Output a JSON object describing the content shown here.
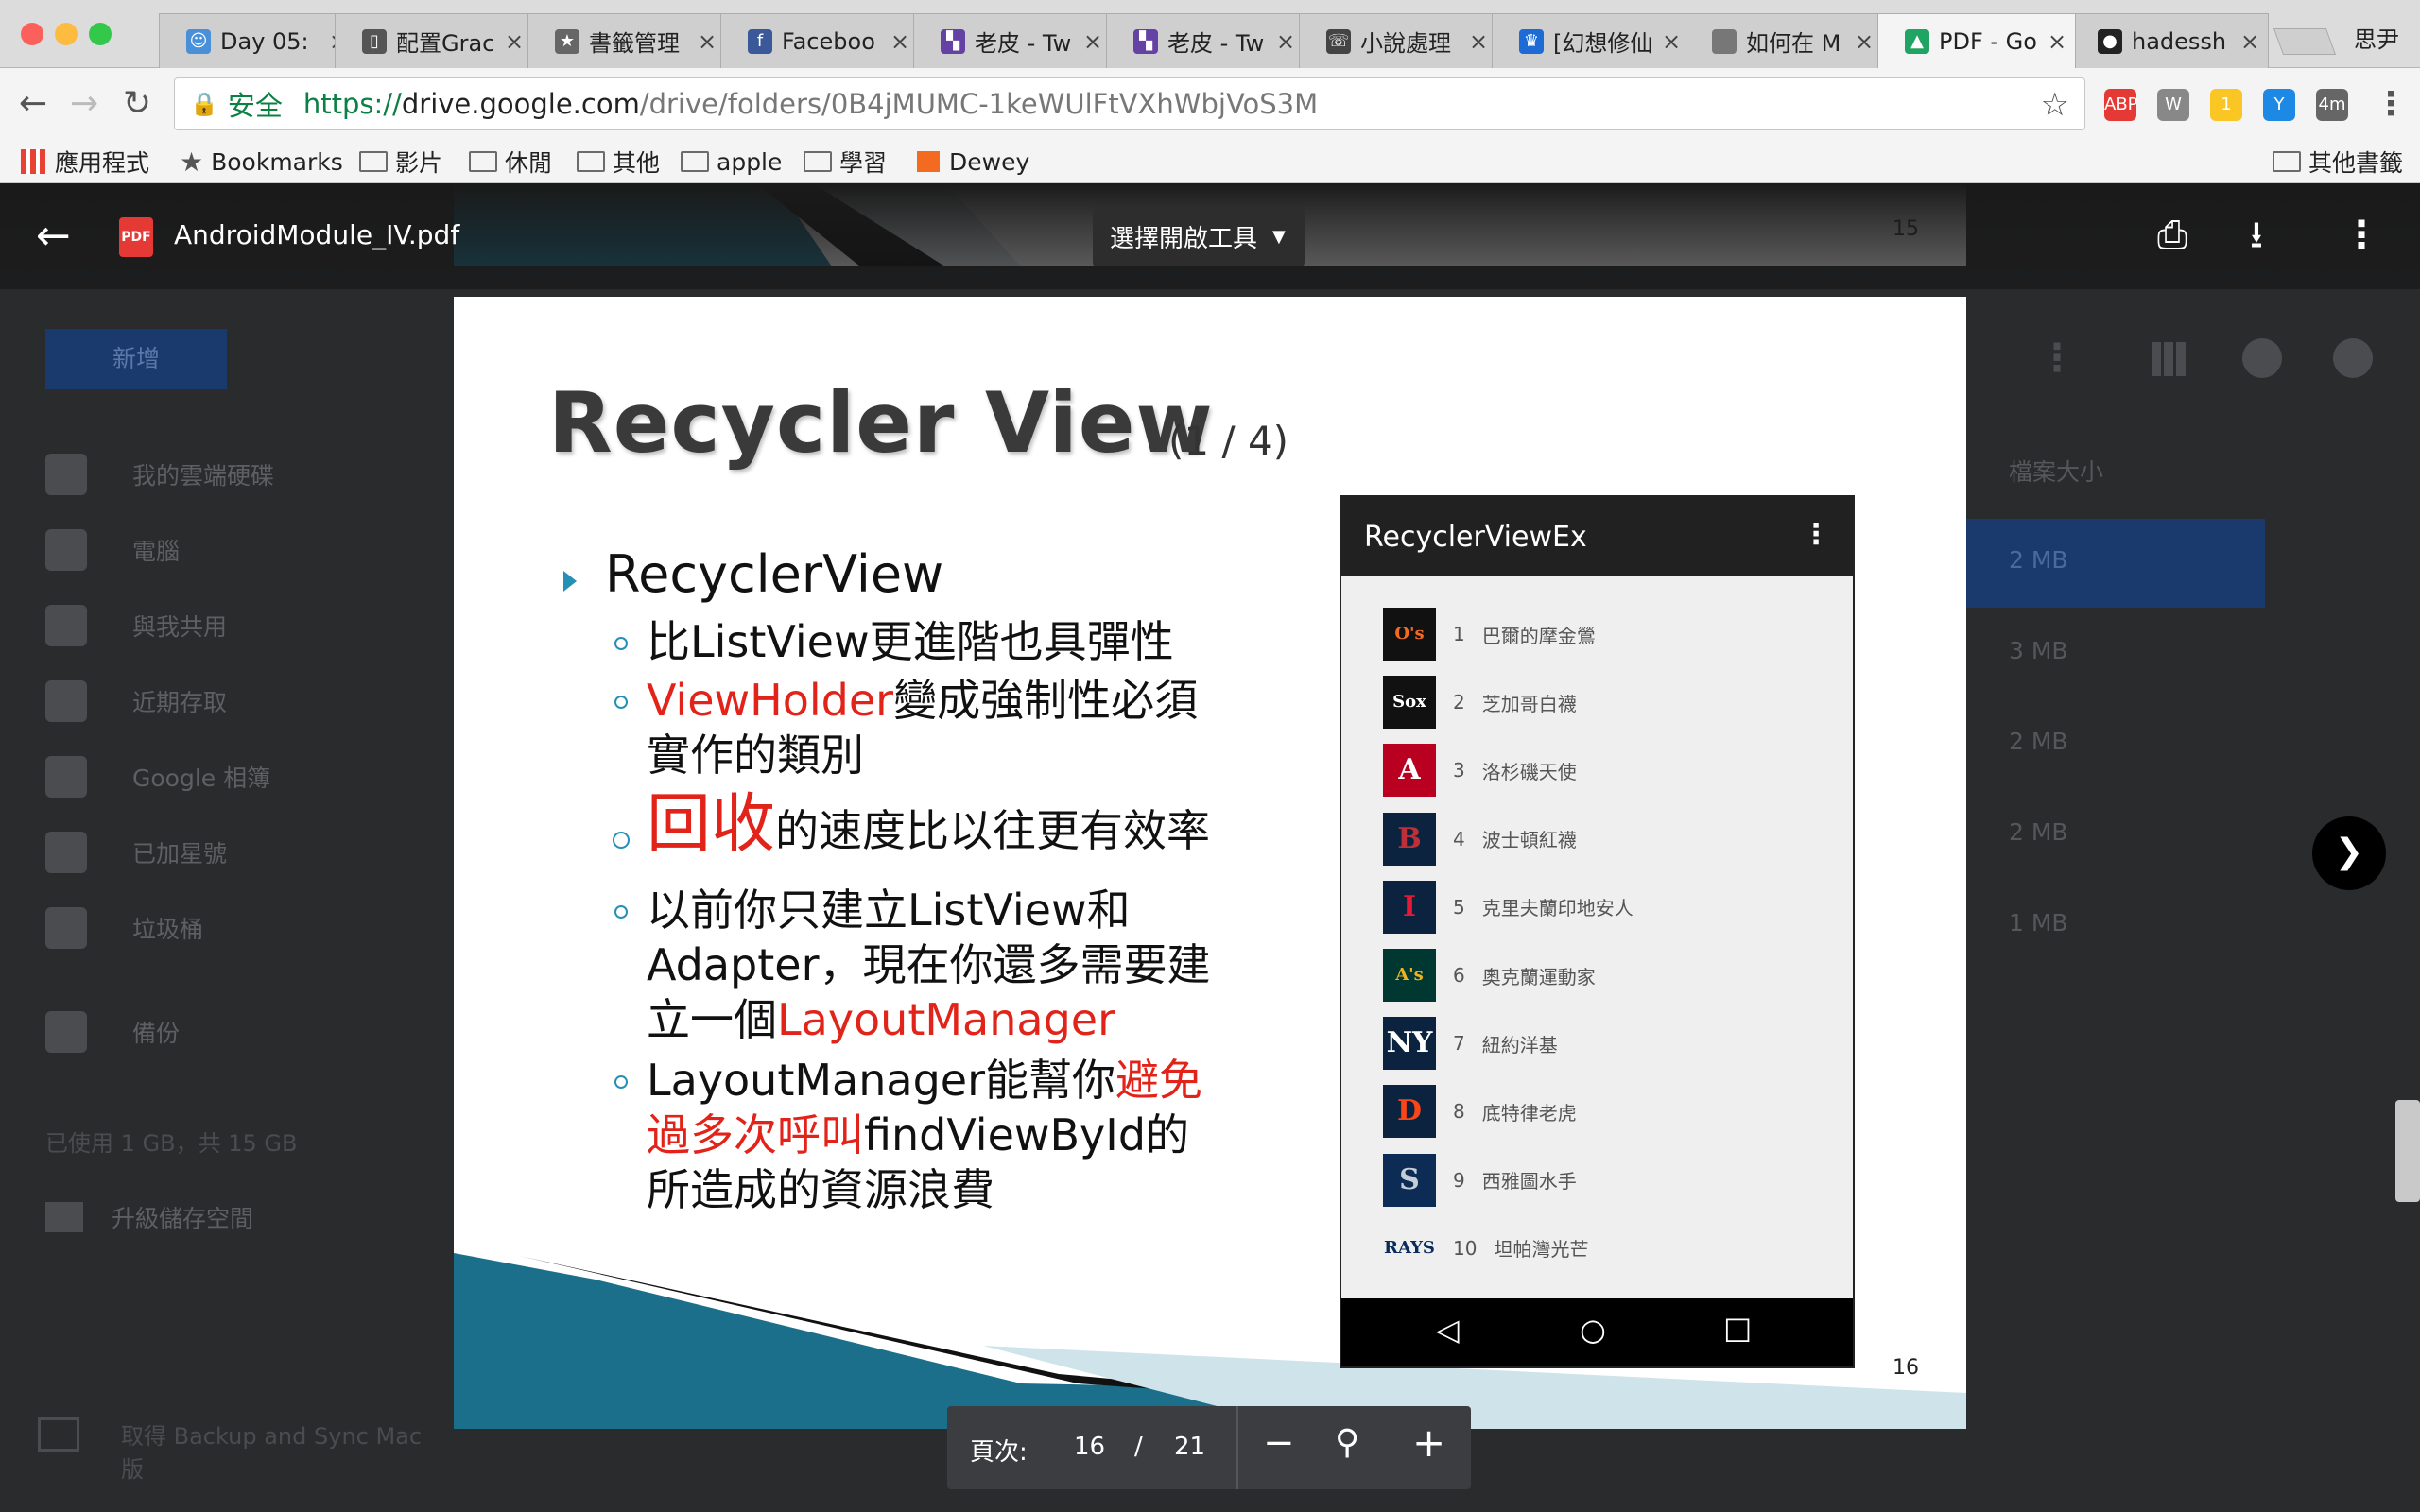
{
  "browser": {
    "tabs": [
      {
        "title": "Day 05:",
        "favicon": "day-icon",
        "active": false
      },
      {
        "title": "配置Grac",
        "favicon": "book-icon",
        "active": false
      },
      {
        "title": "書籤管理",
        "favicon": "star-icon",
        "active": false
      },
      {
        "title": "Faceboo",
        "favicon": "facebook-icon",
        "active": false
      },
      {
        "title": "老皮 - Tw",
        "favicon": "twitch-icon",
        "active": false
      },
      {
        "title": "老皮 - Tw",
        "favicon": "twitch-icon",
        "active": false
      },
      {
        "title": "小說處理",
        "favicon": "phone-icon",
        "active": false
      },
      {
        "title": "[幻想修仙",
        "favicon": "crown-icon",
        "active": false
      },
      {
        "title": "如何在 M",
        "favicon": "apple-icon",
        "active": false
      },
      {
        "title": "PDF - Go",
        "favicon": "drive-icon",
        "active": true
      },
      {
        "title": "hadessh",
        "favicon": "github-icon",
        "active": false
      }
    ],
    "profile_name": "思尹",
    "secure_label": "安全",
    "url_scheme": "https://",
    "url_host": "drive.google.com",
    "url_path": "/drive/folders/0B4jMUMC-1keWUlFtVXhWbjVoS3M",
    "extensions": [
      {
        "name": "abp",
        "label": "ABP",
        "color": "#e53935"
      },
      {
        "name": "w",
        "label": "W",
        "color": "#888888"
      },
      {
        "name": "notes",
        "label": "1",
        "color": "#f9c623"
      },
      {
        "name": "y",
        "label": "Y",
        "color": "#1e88e5"
      },
      {
        "name": "timer",
        "label": "4m",
        "color": "#666666"
      }
    ],
    "bookmarks": [
      {
        "label": "應用程式",
        "type": "apps"
      },
      {
        "label": "Bookmarks",
        "type": "star"
      },
      {
        "label": "影片",
        "type": "folder"
      },
      {
        "label": "休閒",
        "type": "folder"
      },
      {
        "label": "其他",
        "type": "folder"
      },
      {
        "label": "apple",
        "type": "folder"
      },
      {
        "label": "學習",
        "type": "folder"
      },
      {
        "label": "Dewey",
        "type": "dewey"
      }
    ],
    "other_bookmarks": "其他書籤"
  },
  "drive": {
    "new_button": "新增",
    "nav": [
      "我的雲端硬碟",
      "電腦",
      "與我共用",
      "近期存取",
      "Google 相簿",
      "已加星號",
      "垃圾桶",
      "備份"
    ],
    "storage": "已使用 1 GB，共 15 GB",
    "upgrade": "升級儲存空間",
    "backup_promo": "取得 Backup and Sync Mac 版",
    "column_size": "檔案大小",
    "sizes": [
      "2 MB",
      "3 MB",
      "2 MB",
      "2 MB",
      "1 MB"
    ]
  },
  "viewer": {
    "file_name": "AndroidModule_IV.pdf",
    "open_with": "選擇開啟工具",
    "prev_page_number": "15",
    "page_label": "頁次:",
    "current_page": "16",
    "page_separator": "/",
    "total_pages": "21"
  },
  "slide": {
    "title": "Recycler View",
    "title_sub": "(1 / 4)",
    "main_bullet": "RecyclerView",
    "page_number": "16",
    "b1": "比ListView更進階也具彈性",
    "b2_red": "ViewHolder",
    "b2_rest": "變成強制性必須",
    "b2_line2": "實作的類別",
    "b3_red": "回收",
    "b3_rest": "的速度比以往更有效率",
    "b4_line1": "以前你只建立ListView和",
    "b4_line2": "Adapter，現在你還多需要建",
    "b4_line3a": "立一個",
    "b4_line3_red": "LayoutManager",
    "b5_line1a": "LayoutManager能幫你",
    "b5_line1_red": "避免",
    "b5_line2_red": "過多次呼叫",
    "b5_line2b": "findViewById的",
    "b5_line3": "所造成的資源浪費",
    "phone": {
      "app_title": "RecyclerViewEx",
      "teams": [
        {
          "num": "1",
          "name": "巴爾的摩金鶯",
          "logo": "O's",
          "color": "#111111",
          "fg": "#f26b21"
        },
        {
          "num": "2",
          "name": "芝加哥白襪",
          "logo": "Sox",
          "color": "#111111",
          "fg": "#ffffff"
        },
        {
          "num": "3",
          "name": "洛杉磯天使",
          "logo": "A",
          "color": "#ba0021",
          "fg": "#ffffff"
        },
        {
          "num": "4",
          "name": "波士頓紅襪",
          "logo": "B",
          "color": "#0c2340",
          "fg": "#bd3039"
        },
        {
          "num": "5",
          "name": "克里夫蘭印地安人",
          "logo": "I",
          "color": "#0c2340",
          "fg": "#e31937"
        },
        {
          "num": "6",
          "name": "奧克蘭運動家",
          "logo": "A's",
          "color": "#003831",
          "fg": "#efb21e"
        },
        {
          "num": "7",
          "name": "紐約洋基",
          "logo": "NY",
          "color": "#0c2340",
          "fg": "#ffffff"
        },
        {
          "num": "8",
          "name": "底特律老虎",
          "logo": "D",
          "color": "#0c2340",
          "fg": "#fa4616"
        },
        {
          "num": "9",
          "name": "西雅圖水手",
          "logo": "S",
          "color": "#0c2c56",
          "fg": "#c4ced4"
        },
        {
          "num": "10",
          "name": "坦帕灣光芒",
          "logo": "RAYS",
          "color": "#efefef",
          "fg": "#092c5c"
        }
      ]
    }
  }
}
